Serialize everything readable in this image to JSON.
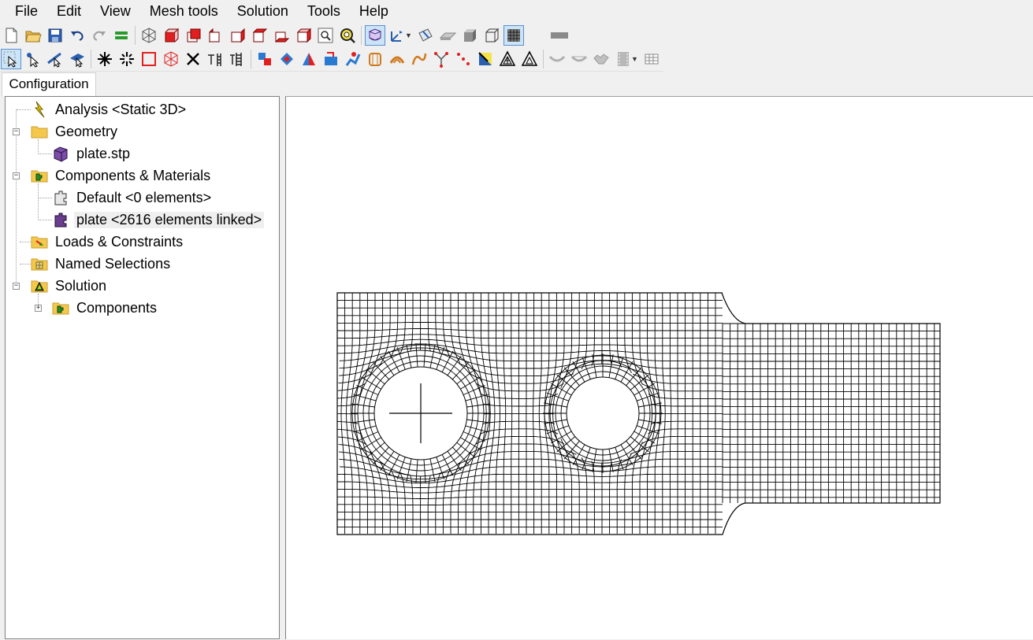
{
  "menubar": {
    "items": [
      "File",
      "Edit",
      "View",
      "Mesh tools",
      "Solution",
      "Tools",
      "Help"
    ]
  },
  "toolbar1": {
    "buttons": [
      "new-document-icon",
      "open-folder-icon",
      "save-icon",
      "undo-icon",
      "redo-icon",
      "layers-icon",
      "view-iso-wire-icon",
      "view-front-icon",
      "view-back-icon",
      "view-left-icon",
      "view-right-icon",
      "view-top-icon",
      "view-bottom-icon",
      "zoom-window-icon",
      "zoom-fit-icon",
      "mesh-display-icon",
      "coordinate-system-icon",
      "section-plane-icon",
      "render-flat-icon",
      "render-shaded-icon",
      "render-wireframe-icon",
      "render-mesh-icon",
      "color-bar-icon"
    ]
  },
  "toolbar2": {
    "buttons": [
      "select-pointer-icon",
      "select-node-icon",
      "select-edge-icon",
      "select-face-icon",
      "select-node-star-icon",
      "select-element-icon",
      "select-box-icon",
      "select-body-icon",
      "delete-icon",
      "split-icon",
      "ladder-icon",
      "fixed-support-icon",
      "displacement-icon",
      "force-icon",
      "pressure-icon",
      "moment-icon",
      "remote-load-icon",
      "bearing-load-icon",
      "bolt-icon",
      "cylindrical-support-icon",
      "spring-icon",
      "frictionless-icon",
      "point-mass-icon",
      "triangle-outline-icon",
      "triangle-hatch-icon",
      "triangle-icon",
      "contact-region-icon",
      "contact-bonded-icon",
      "contact-body-icon",
      "film-icon",
      "table-grid-icon"
    ]
  },
  "tabs": {
    "configuration_label": "Configuration"
  },
  "tree": {
    "analysis": "Analysis <Static 3D>",
    "geometry": "Geometry",
    "geometry_file": "plate.stp",
    "components_materials": "Components & Materials",
    "component_default": "Default <0 elements>",
    "component_plate": "plate <2616 elements linked>",
    "loads_constraints": "Loads & Constraints",
    "named_selections": "Named Selections",
    "solution": "Solution",
    "solution_components": "Components"
  },
  "colors": {
    "folder_yellow": "#f5c84c",
    "component_purple": "#6a3d8e",
    "analysis_lightning": "#f0d000",
    "mesh_line": "#000000",
    "select_highlight": "#cce4f7",
    "face_red": "#e02020"
  }
}
